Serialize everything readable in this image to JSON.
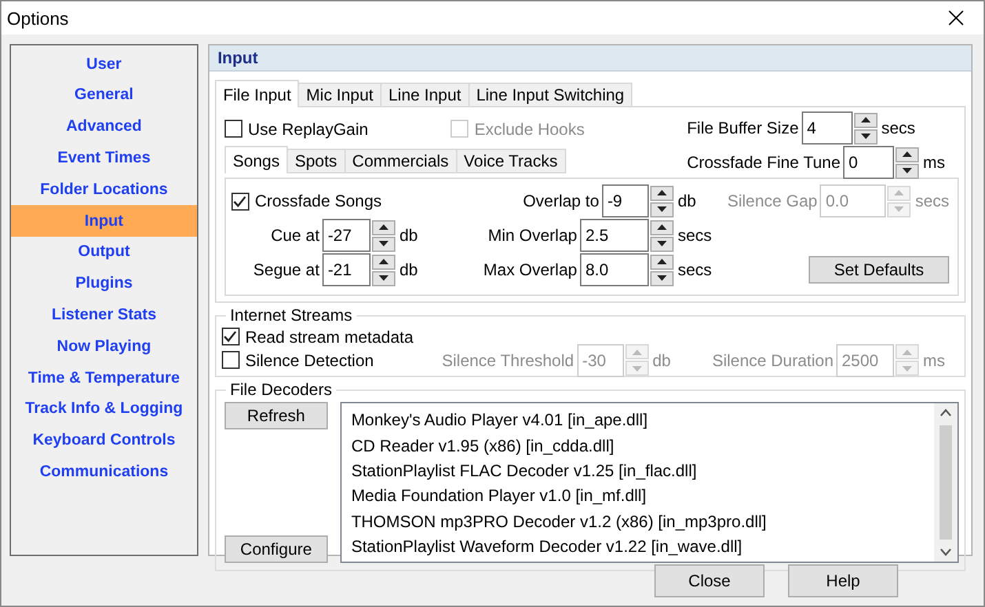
{
  "window": {
    "title": "Options"
  },
  "sidebar": {
    "items": [
      {
        "label": "User",
        "selected": false
      },
      {
        "label": "General",
        "selected": false
      },
      {
        "label": "Advanced",
        "selected": false
      },
      {
        "label": "Event Times",
        "selected": false
      },
      {
        "label": "Folder Locations",
        "selected": false
      },
      {
        "label": "Input",
        "selected": true
      },
      {
        "label": "Output",
        "selected": false
      },
      {
        "label": "Plugins",
        "selected": false
      },
      {
        "label": "Listener Stats",
        "selected": false
      },
      {
        "label": "Now Playing",
        "selected": false
      },
      {
        "label": "Time & Temperature",
        "selected": false
      },
      {
        "label": "Track Info & Logging",
        "selected": false
      },
      {
        "label": "Keyboard Controls",
        "selected": false
      },
      {
        "label": "Communications",
        "selected": false
      }
    ]
  },
  "panel": {
    "title": "Input"
  },
  "input_tabs": [
    {
      "label": "File Input",
      "selected": true
    },
    {
      "label": "Mic Input",
      "selected": false
    },
    {
      "label": "Line Input",
      "selected": false
    },
    {
      "label": "Line Input Switching",
      "selected": false
    }
  ],
  "file_options": [
    {
      "label": "Use ReplayGain",
      "checked": false,
      "disabled": false
    },
    {
      "label": "Exclude Hooks",
      "checked": false,
      "disabled": true
    }
  ],
  "buffer_fields": [
    {
      "label": "File Buffer Size",
      "value": "4",
      "unit": "secs",
      "disabled": false
    },
    {
      "label": "Crossfade Fine Tune",
      "value": "0",
      "unit": "ms",
      "disabled": false
    }
  ],
  "category_tabs": [
    {
      "label": "Songs",
      "selected": true
    },
    {
      "label": "Spots",
      "selected": false
    },
    {
      "label": "Commercials",
      "selected": false
    },
    {
      "label": "Voice Tracks",
      "selected": false
    }
  ],
  "songs": {
    "crossfade": {
      "label": "Crossfade Songs",
      "checked": true,
      "disabled": false
    },
    "left_fields": [
      {
        "label": "Cue at",
        "value": "-27",
        "unit": "db",
        "disabled": false
      },
      {
        "label": "Segue at",
        "value": "-21",
        "unit": "db",
        "disabled": false
      }
    ],
    "middle_fields": [
      {
        "label": "Overlap to",
        "value": "-9",
        "unit": "db",
        "disabled": false
      },
      {
        "label": "Min Overlap",
        "value": "2.5",
        "unit": "secs",
        "disabled": false
      },
      {
        "label": "Max Overlap",
        "value": "8.0",
        "unit": "secs",
        "disabled": false
      }
    ],
    "right_fields": [
      {
        "label": "Silence Gap",
        "value": "0.0",
        "unit": "secs",
        "disabled": true
      }
    ],
    "set_defaults": "Set Defaults"
  },
  "internet_streams": {
    "title": "Internet Streams",
    "options": [
      {
        "label": "Read stream metadata",
        "checked": true,
        "disabled": false
      },
      {
        "label": "Silence Detection",
        "checked": false,
        "disabled": false
      }
    ],
    "fields": [
      {
        "label": "Silence Threshold",
        "value": "-30",
        "unit": "db",
        "disabled": true
      },
      {
        "label": "Silence Duration",
        "value": "2500",
        "unit": "ms",
        "disabled": true
      }
    ]
  },
  "file_decoders": {
    "title": "File Decoders",
    "buttons": [
      "Refresh",
      "Configure"
    ],
    "items": [
      "Monkey's Audio Player v4.01 [in_ape.dll]",
      "CD Reader v1.95 (x86) [in_cdda.dll]",
      "StationPlaylist FLAC Decoder v1.25 [in_flac.dll]",
      "Media Foundation Player v1.0 [in_mf.dll]",
      "THOMSON mp3PRO Decoder v1.2 (x86) [in_mp3pro.dll]",
      "StationPlaylist Waveform Decoder v1.22 [in_wave.dll]"
    ]
  },
  "footer_buttons": [
    "Close",
    "Help"
  ]
}
